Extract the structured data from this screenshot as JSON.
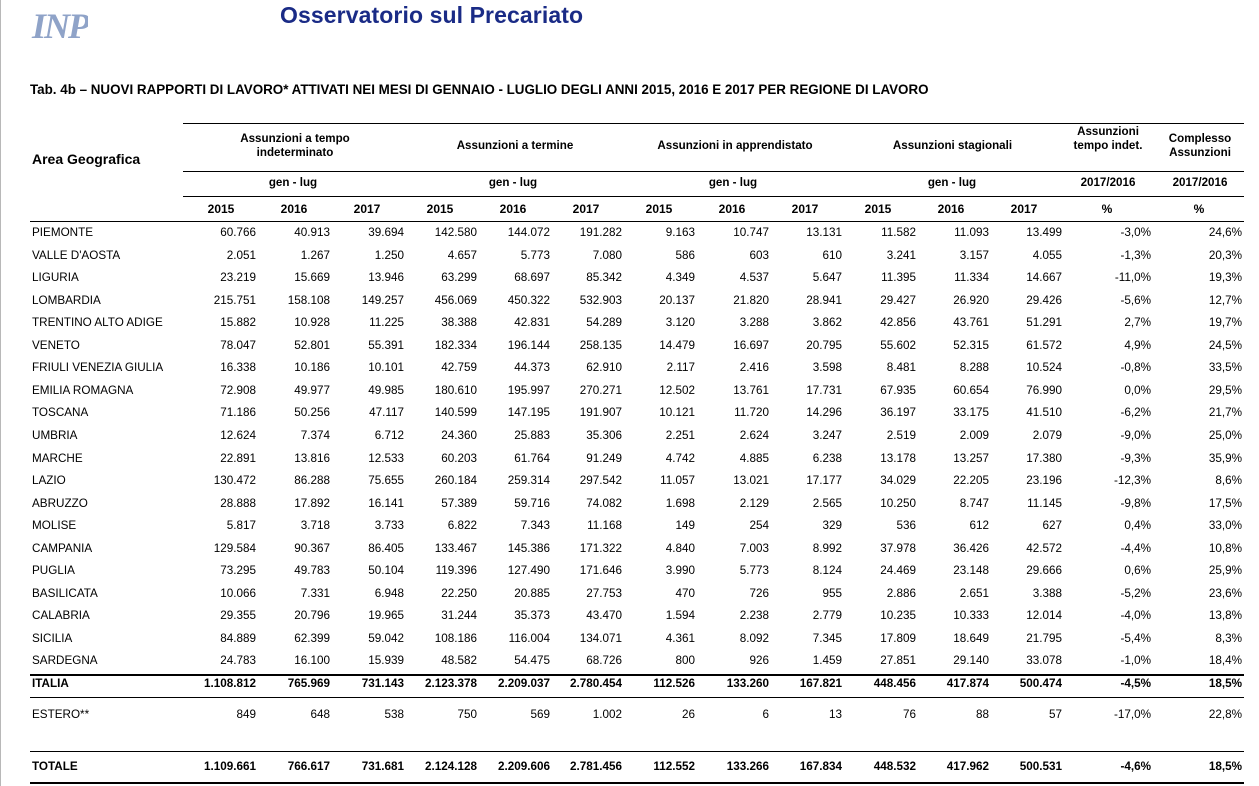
{
  "header": {
    "logo_text": "INPS",
    "title": "Osservatorio sul Precariato",
    "table_caption": "Tab. 4b – NUOVI RAPPORTI DI LAVORO* ATTIVATI NEI MESI DI GENNAIO - LUGLIO DEGLI ANNI 2015, 2016 E 2017 PER REGIONE DI LAVORO"
  },
  "columns": {
    "area": "Area Geografica",
    "groups": [
      "Assunzioni a tempo indeterminato",
      "Assunzioni a termine",
      "Assunzioni in apprendistato",
      "Assunzioni stagionali",
      "Assunzioni tempo indet.",
      "Complesso Assunzioni"
    ],
    "period": "gen - lug",
    "var_period": "2017/2016",
    "years": [
      "2015",
      "2016",
      "2017",
      "2015",
      "2016",
      "2017",
      "2015",
      "2016",
      "2017",
      "2015",
      "2016",
      "2017",
      "%",
      "%"
    ]
  },
  "rows": [
    {
      "name": "PIEMONTE",
      "values": [
        "60.766",
        "40.913",
        "39.694",
        "142.580",
        "144.072",
        "191.282",
        "9.163",
        "10.747",
        "13.131",
        "11.582",
        "11.093",
        "13.499",
        "-3,0%",
        "24,6%"
      ]
    },
    {
      "name": "VALLE D'AOSTA",
      "values": [
        "2.051",
        "1.267",
        "1.250",
        "4.657",
        "5.773",
        "7.080",
        "586",
        "603",
        "610",
        "3.241",
        "3.157",
        "4.055",
        "-1,3%",
        "20,3%"
      ]
    },
    {
      "name": "LIGURIA",
      "values": [
        "23.219",
        "15.669",
        "13.946",
        "63.299",
        "68.697",
        "85.342",
        "4.349",
        "4.537",
        "5.647",
        "11.395",
        "11.334",
        "14.667",
        "-11,0%",
        "19,3%"
      ]
    },
    {
      "name": "LOMBARDIA",
      "values": [
        "215.751",
        "158.108",
        "149.257",
        "456.069",
        "450.322",
        "532.903",
        "20.137",
        "21.820",
        "28.941",
        "29.427",
        "26.920",
        "29.426",
        "-5,6%",
        "12,7%"
      ]
    },
    {
      "name": "TRENTINO ALTO ADIGE",
      "values": [
        "15.882",
        "10.928",
        "11.225",
        "38.388",
        "42.831",
        "54.289",
        "3.120",
        "3.288",
        "3.862",
        "42.856",
        "43.761",
        "51.291",
        "2,7%",
        "19,7%"
      ]
    },
    {
      "name": "VENETO",
      "values": [
        "78.047",
        "52.801",
        "55.391",
        "182.334",
        "196.144",
        "258.135",
        "14.479",
        "16.697",
        "20.795",
        "55.602",
        "52.315",
        "61.572",
        "4,9%",
        "24,5%"
      ]
    },
    {
      "name": "FRIULI VENEZIA GIULIA",
      "values": [
        "16.338",
        "10.186",
        "10.101",
        "42.759",
        "44.373",
        "62.910",
        "2.117",
        "2.416",
        "3.598",
        "8.481",
        "8.288",
        "10.524",
        "-0,8%",
        "33,5%"
      ]
    },
    {
      "name": "EMILIA ROMAGNA",
      "values": [
        "72.908",
        "49.977",
        "49.985",
        "180.610",
        "195.997",
        "270.271",
        "12.502",
        "13.761",
        "17.731",
        "67.935",
        "60.654",
        "76.990",
        "0,0%",
        "29,5%"
      ]
    },
    {
      "name": "TOSCANA",
      "values": [
        "71.186",
        "50.256",
        "47.117",
        "140.599",
        "147.195",
        "191.907",
        "10.121",
        "11.720",
        "14.296",
        "36.197",
        "33.175",
        "41.510",
        "-6,2%",
        "21,7%"
      ]
    },
    {
      "name": "UMBRIA",
      "values": [
        "12.624",
        "7.374",
        "6.712",
        "24.360",
        "25.883",
        "35.306",
        "2.251",
        "2.624",
        "3.247",
        "2.519",
        "2.009",
        "2.079",
        "-9,0%",
        "25,0%"
      ]
    },
    {
      "name": "MARCHE",
      "values": [
        "22.891",
        "13.816",
        "12.533",
        "60.203",
        "61.764",
        "91.249",
        "4.742",
        "4.885",
        "6.238",
        "13.178",
        "13.257",
        "17.380",
        "-9,3%",
        "35,9%"
      ]
    },
    {
      "name": "LAZIO",
      "values": [
        "130.472",
        "86.288",
        "75.655",
        "260.184",
        "259.314",
        "297.542",
        "11.057",
        "13.021",
        "17.177",
        "34.029",
        "22.205",
        "23.196",
        "-12,3%",
        "8,6%"
      ]
    },
    {
      "name": "ABRUZZO",
      "values": [
        "28.888",
        "17.892",
        "16.141",
        "57.389",
        "59.716",
        "74.082",
        "1.698",
        "2.129",
        "2.565",
        "10.250",
        "8.747",
        "11.145",
        "-9,8%",
        "17,5%"
      ]
    },
    {
      "name": "MOLISE",
      "values": [
        "5.817",
        "3.718",
        "3.733",
        "6.822",
        "7.343",
        "11.168",
        "149",
        "254",
        "329",
        "536",
        "612",
        "627",
        "0,4%",
        "33,0%"
      ]
    },
    {
      "name": "CAMPANIA",
      "values": [
        "129.584",
        "90.367",
        "86.405",
        "133.467",
        "145.386",
        "171.322",
        "4.840",
        "7.003",
        "8.992",
        "37.978",
        "36.426",
        "42.572",
        "-4,4%",
        "10,8%"
      ]
    },
    {
      "name": "PUGLIA",
      "values": [
        "73.295",
        "49.783",
        "50.104",
        "119.396",
        "127.490",
        "171.646",
        "3.990",
        "5.773",
        "8.124",
        "24.469",
        "23.148",
        "29.666",
        "0,6%",
        "25,9%"
      ]
    },
    {
      "name": "BASILICATA",
      "values": [
        "10.066",
        "7.331",
        "6.948",
        "22.250",
        "20.885",
        "27.753",
        "470",
        "726",
        "955",
        "2.886",
        "2.651",
        "3.388",
        "-5,2%",
        "23,6%"
      ]
    },
    {
      "name": "CALABRIA",
      "values": [
        "29.355",
        "20.796",
        "19.965",
        "31.244",
        "35.373",
        "43.470",
        "1.594",
        "2.238",
        "2.779",
        "10.235",
        "10.333",
        "12.014",
        "-4,0%",
        "13,8%"
      ]
    },
    {
      "name": "SICILIA",
      "values": [
        "84.889",
        "62.399",
        "59.042",
        "108.186",
        "116.004",
        "134.071",
        "4.361",
        "8.092",
        "7.345",
        "17.809",
        "18.649",
        "21.795",
        "-5,4%",
        "8,3%"
      ]
    },
    {
      "name": "SARDEGNA",
      "values": [
        "24.783",
        "16.100",
        "15.939",
        "48.582",
        "54.475",
        "68.726",
        "800",
        "926",
        "1.459",
        "27.851",
        "29.140",
        "33.078",
        "-1,0%",
        "18,4%"
      ]
    }
  ],
  "italia": {
    "name": "ITALIA",
    "values": [
      "1.108.812",
      "765.969",
      "731.143",
      "2.123.378",
      "2.209.037",
      "2.780.454",
      "112.526",
      "133.260",
      "167.821",
      "448.456",
      "417.874",
      "500.474",
      "-4,5%",
      "18,5%"
    ]
  },
  "estero": {
    "name": "ESTERO**",
    "values": [
      "849",
      "648",
      "538",
      "750",
      "569",
      "1.002",
      "26",
      "6",
      "13",
      "76",
      "88",
      "57",
      "-17,0%",
      "22,8%"
    ]
  },
  "totale": {
    "name": "TOTALE",
    "values": [
      "1.109.661",
      "766.617",
      "731.681",
      "2.124.128",
      "2.209.606",
      "2.781.456",
      "112.552",
      "133.266",
      "167.834",
      "448.532",
      "417.962",
      "500.531",
      "-4,6%",
      "18,5%"
    ]
  },
  "style": {
    "title_color": "#1a2b86",
    "logo_color": "#8fa3c8"
  }
}
